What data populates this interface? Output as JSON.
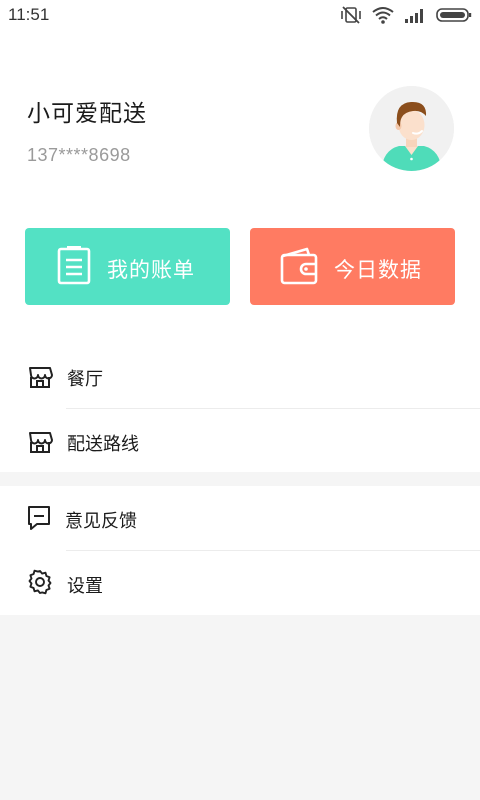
{
  "status_bar": {
    "time": "11:51",
    "icons": [
      "vibrate-off-icon",
      "wifi-icon",
      "signal-icon",
      "battery-icon"
    ]
  },
  "profile": {
    "name": "小可爱配送",
    "phone": "137****8698",
    "avatar": "avatar-icon"
  },
  "cards": {
    "bill": {
      "label": "我的账单",
      "icon": "document-icon",
      "color": "#53e1c4"
    },
    "today": {
      "label": "今日数据",
      "icon": "wallet-icon",
      "color": "#ff7b62"
    }
  },
  "menu": {
    "restaurant": {
      "label": "餐厅",
      "icon": "shop-icon"
    },
    "route": {
      "label": "配送路线",
      "icon": "shop-icon"
    },
    "feedback": {
      "label": "意见反馈",
      "icon": "message-icon"
    },
    "settings": {
      "label": "设置",
      "icon": "gear-icon"
    }
  },
  "colors": {
    "accent_green": "#53e1c4",
    "accent_orange": "#ff7b62",
    "background": "#f5f5f5"
  }
}
